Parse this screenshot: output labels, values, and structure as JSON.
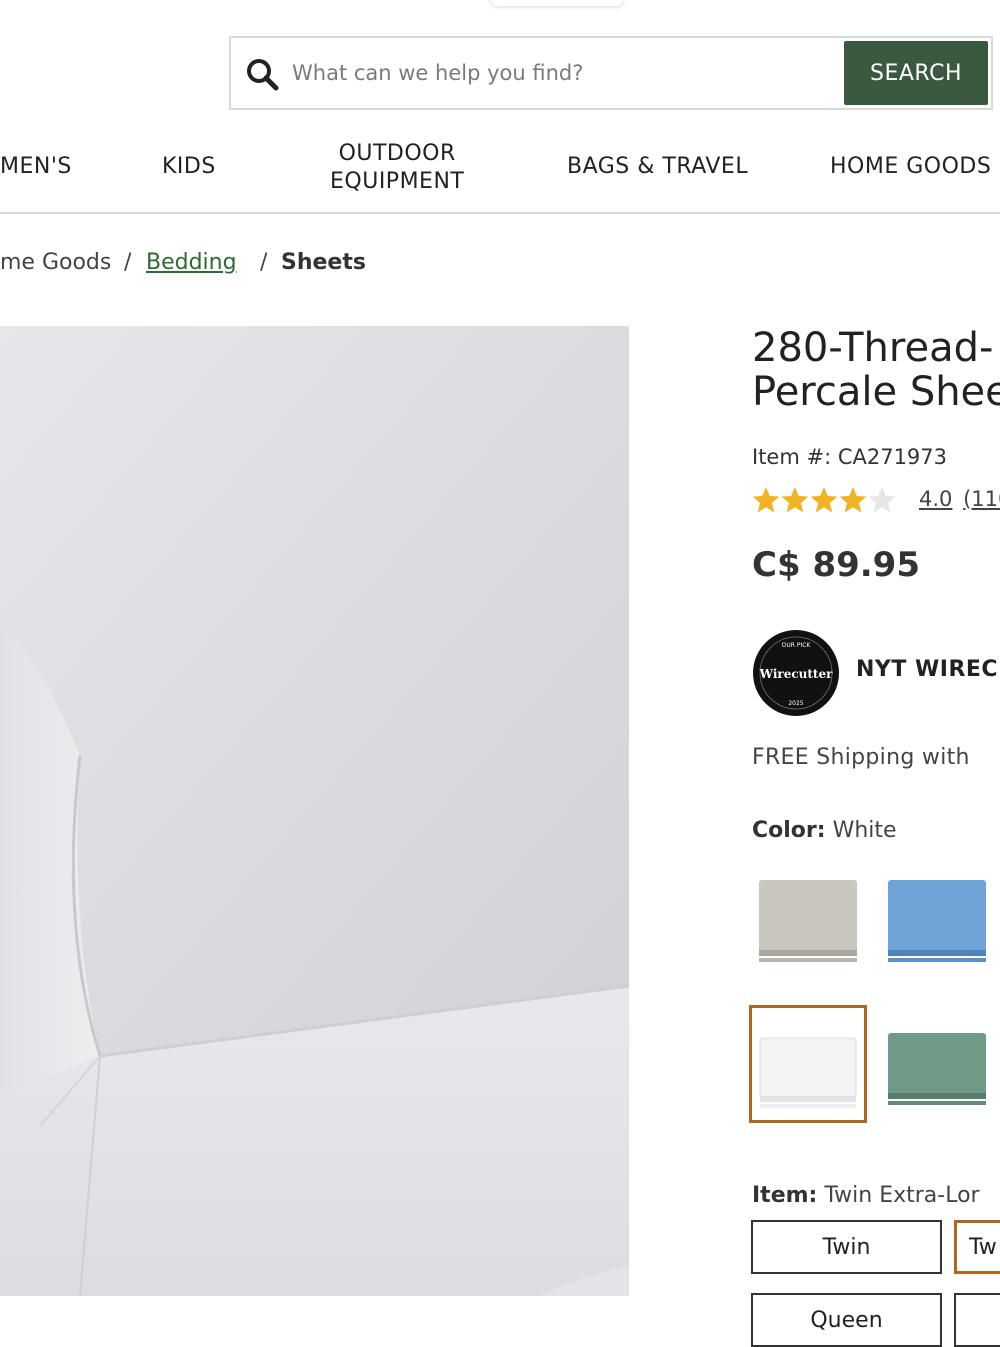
{
  "search": {
    "placeholder": "What can we help you find?",
    "button_label": "SEARCH"
  },
  "nav": {
    "items": [
      {
        "label": "MEN'S"
      },
      {
        "label": "KIDS"
      },
      {
        "label": "OUTDOOR\nEQUIPMENT"
      },
      {
        "label": "BAGS & TRAVEL"
      },
      {
        "label": "HOME GOODS"
      }
    ]
  },
  "breadcrumb": {
    "parent": "me Goods",
    "sep1": "/",
    "link": "Bedding",
    "sep2": "/",
    "current": "Sheets"
  },
  "product": {
    "title_line1": "280-Thread-",
    "title_line2": "Percale Shee",
    "item_number": "Item #: CA271973",
    "rating_value": "4.0",
    "rating_count": "(110",
    "rating_stars": 4,
    "price": "C$ 89.95",
    "badge_text": "NYT WIREC",
    "shipping": "FREE Shipping with",
    "color_label": "Color:",
    "color_value": "White",
    "item_label": "Item:",
    "item_value": "Twin Extra-Lor"
  },
  "colors": {
    "accent_green": "#3a5a40",
    "link_green": "#2e6b2e",
    "selected_outline": "#b5651d",
    "star": "#f0b323"
  },
  "swatches": [
    {
      "name": "Gray",
      "color": "#c9c6c0"
    },
    {
      "name": "Blue",
      "color": "#6fa3d8"
    },
    {
      "name": "White",
      "color": "#f2f2f4",
      "selected": true
    },
    {
      "name": "Green",
      "color": "#6f9a86"
    }
  ],
  "sizes": [
    {
      "label": "Twin"
    },
    {
      "label": "Tw",
      "selected": true
    },
    {
      "label": "Queen"
    },
    {
      "label": ""
    }
  ],
  "badge": {
    "top": "OUR PICK",
    "middle": "Wirecutter",
    "bottom": "2025"
  }
}
